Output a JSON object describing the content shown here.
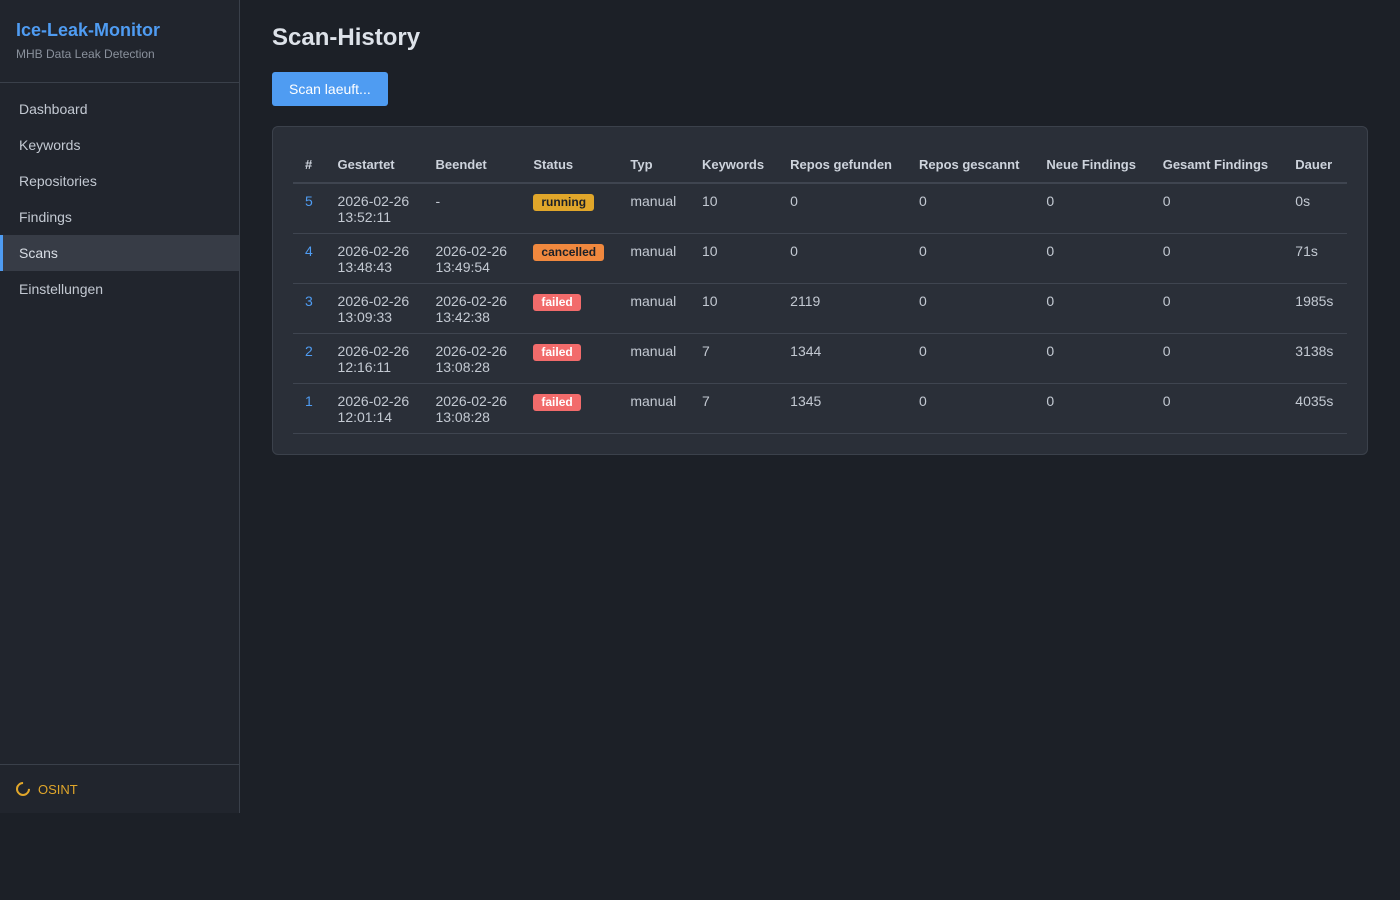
{
  "sidebar": {
    "brand_title": "Ice-Leak-Monitor",
    "brand_subtitle": "MHB Data Leak Detection",
    "items": [
      {
        "label": "Dashboard",
        "active": false
      },
      {
        "label": "Keywords",
        "active": false
      },
      {
        "label": "Repositories",
        "active": false
      },
      {
        "label": "Findings",
        "active": false
      },
      {
        "label": "Scans",
        "active": true
      },
      {
        "label": "Einstellungen",
        "active": false
      }
    ],
    "footer_status": "OSINT"
  },
  "main": {
    "title": "Scan-History",
    "scan_button": "Scan laeuft...",
    "table": {
      "headers": [
        "#",
        "Gestartet",
        "Beendet",
        "Status",
        "Typ",
        "Keywords",
        "Repos gefunden",
        "Repos gescannt",
        "Neue Findings",
        "Gesamt Findings",
        "Dauer"
      ],
      "rows": [
        {
          "id": "5",
          "started_date": "2026-02-26",
          "started_time": "13:52:11",
          "ended_date": "-",
          "ended_time": "",
          "status": "running",
          "type": "manual",
          "keywords": "10",
          "repos_found": "0",
          "repos_scanned": "0",
          "new_findings": "0",
          "total_findings": "0",
          "duration": "0s"
        },
        {
          "id": "4",
          "started_date": "2026-02-26",
          "started_time": "13:48:43",
          "ended_date": "2026-02-26",
          "ended_time": "13:49:54",
          "status": "cancelled",
          "type": "manual",
          "keywords": "10",
          "repos_found": "0",
          "repos_scanned": "0",
          "new_findings": "0",
          "total_findings": "0",
          "duration": "71s"
        },
        {
          "id": "3",
          "started_date": "2026-02-26",
          "started_time": "13:09:33",
          "ended_date": "2026-02-26",
          "ended_time": "13:42:38",
          "status": "failed",
          "type": "manual",
          "keywords": "10",
          "repos_found": "2119",
          "repos_scanned": "0",
          "new_findings": "0",
          "total_findings": "0",
          "duration": "1985s"
        },
        {
          "id": "2",
          "started_date": "2026-02-26",
          "started_time": "12:16:11",
          "ended_date": "2026-02-26",
          "ended_time": "13:08:28",
          "status": "failed",
          "type": "manual",
          "keywords": "7",
          "repos_found": "1344",
          "repos_scanned": "0",
          "new_findings": "0",
          "total_findings": "0",
          "duration": "3138s"
        },
        {
          "id": "1",
          "started_date": "2026-02-26",
          "started_time": "12:01:14",
          "ended_date": "2026-02-26",
          "ended_time": "13:08:28",
          "status": "failed",
          "type": "manual",
          "keywords": "7",
          "repos_found": "1345",
          "repos_scanned": "0",
          "new_findings": "0",
          "total_findings": "0",
          "duration": "4035s"
        }
      ]
    }
  },
  "colors": {
    "accent": "#4f9cf2",
    "running": "#e0a62a",
    "cancelled": "#f0883e",
    "failed": "#f26b6b"
  },
  "icons": {
    "footer_status": "spinner-icon"
  }
}
